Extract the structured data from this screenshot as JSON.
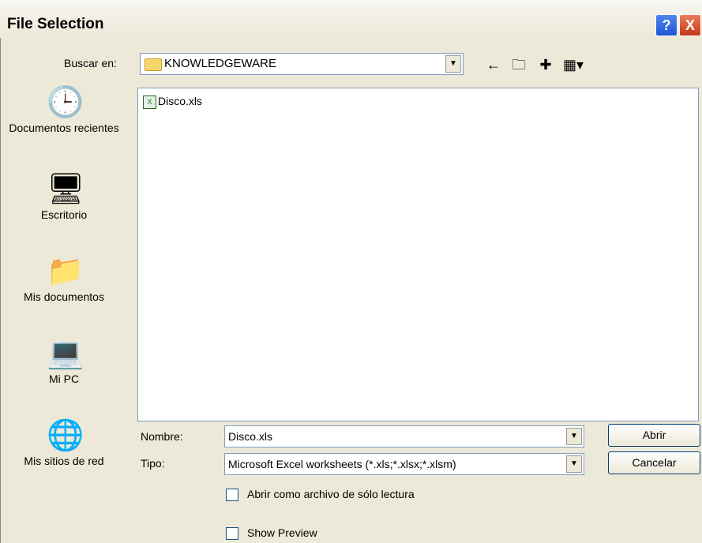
{
  "window": {
    "title": "File Selection",
    "help": "?",
    "close": "X"
  },
  "lookin": {
    "label": "Buscar en:",
    "value": "KNOWLEDGEWARE"
  },
  "toolbar": {
    "back_icon": "back-arrow-icon",
    "up_icon": "folder-up-icon",
    "new_icon": "new-folder-icon",
    "view_icon": "view-menu-icon"
  },
  "places": [
    {
      "label": "Documentos recientes",
      "icon": "recent-documents-icon"
    },
    {
      "label": "Escritorio",
      "icon": "desktop-icon"
    },
    {
      "label": "Mis documentos",
      "icon": "my-documents-icon"
    },
    {
      "label": "Mi PC",
      "icon": "my-computer-icon"
    },
    {
      "label": "Mis sitios de red",
      "icon": "network-places-icon"
    }
  ],
  "files": [
    {
      "name": "Disco.xls",
      "icon": "excel-file-icon"
    }
  ],
  "form": {
    "name_label": "Nombre:",
    "name_value": "Disco.xls",
    "type_label": "Tipo:",
    "type_value": "Microsoft Excel worksheets (*.xls;*.xlsx;*.xlsm)",
    "readonly_label": "Abrir como archivo de sólo lectura",
    "preview_label": "Show Preview"
  },
  "buttons": {
    "open": "Abrir",
    "cancel": "Cancelar"
  }
}
